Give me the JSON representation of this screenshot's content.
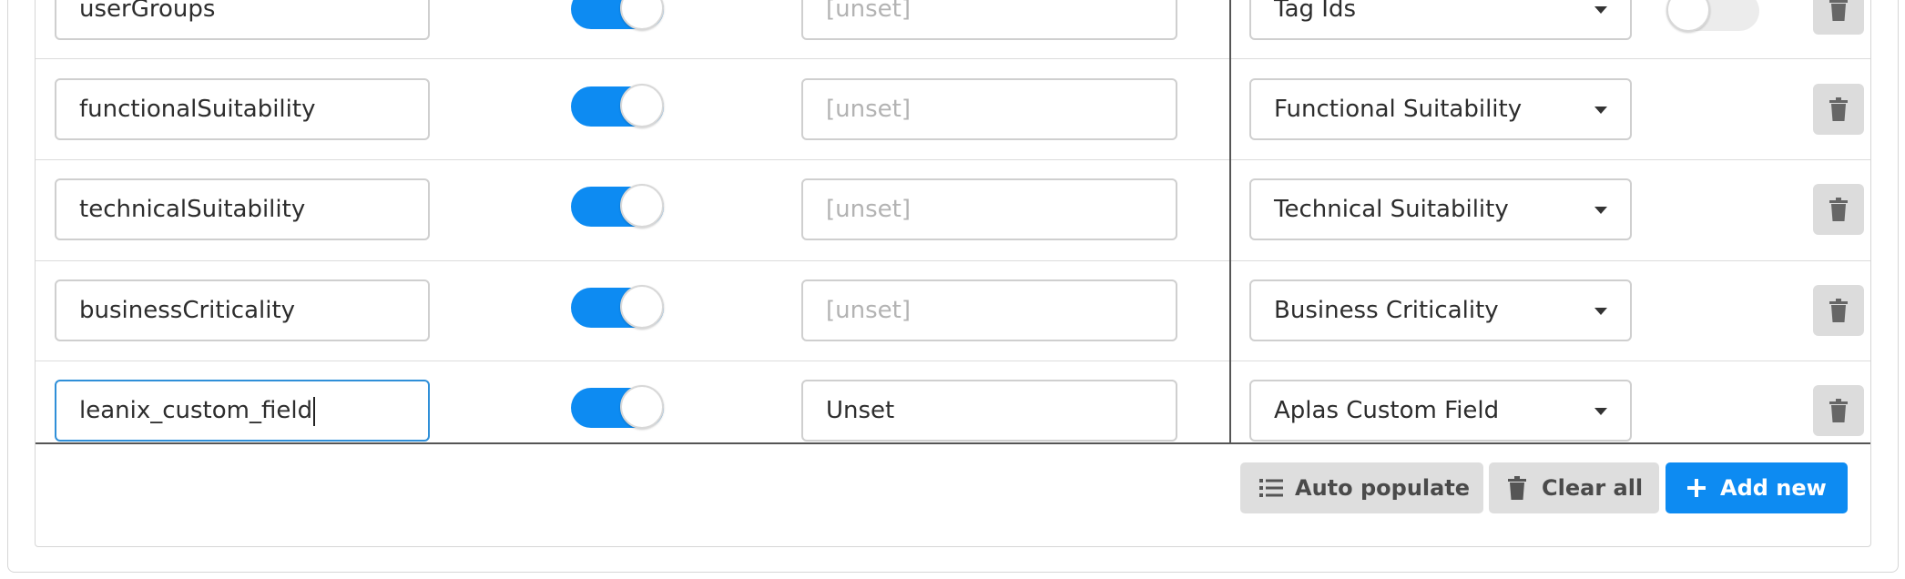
{
  "mapping_rows": [
    {
      "field": "userGroups",
      "enabled": true,
      "default_placeholder": "[unset]",
      "default_value": "",
      "target": "Tag Ids"
    },
    {
      "field": "functionalSuitability",
      "enabled": true,
      "default_placeholder": "[unset]",
      "default_value": "",
      "target": "Functional Suitability"
    },
    {
      "field": "technicalSuitability",
      "enabled": true,
      "default_placeholder": "[unset]",
      "default_value": "",
      "target": "Technical Suitability"
    },
    {
      "field": "businessCriticality",
      "enabled": true,
      "default_placeholder": "[unset]",
      "default_value": "",
      "target": "Business Criticality"
    },
    {
      "field": "leanix_custom_field",
      "enabled": true,
      "default_placeholder": "",
      "default_value": "Unset",
      "target": "Aplas Custom Field"
    }
  ],
  "partial_row_extra_toggle": {
    "enabled": false
  },
  "footer": {
    "auto_populate_label": "Auto populate",
    "clear_all_label": "Clear all",
    "add_new_label": "Add new"
  },
  "colors": {
    "accent": "#0d8bf2",
    "button_grey": "#dedede",
    "border": "#cfcfcf",
    "focus_border": "#2f8fd8"
  },
  "icons": {
    "row_action": "trash-icon",
    "auto_populate": "list-icon",
    "clear_all": "trash-icon",
    "add_new": "plus-icon",
    "select": "chevron-down-icon"
  }
}
